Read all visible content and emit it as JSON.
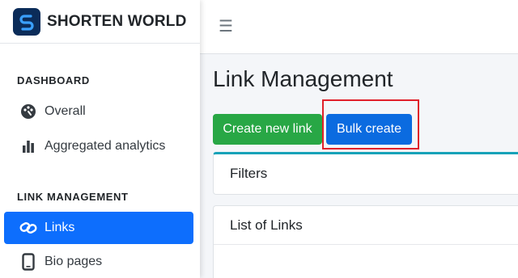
{
  "brand": {
    "name": "SHORTEN WORLD",
    "logo_icon": "s-link-logo"
  },
  "sidebar": {
    "sections": [
      {
        "title": "DASHBOARD"
      },
      {
        "title": "LINK MANAGEMENT"
      }
    ],
    "items": [
      {
        "label": "Overall",
        "icon": "palette-icon"
      },
      {
        "label": "Aggregated analytics",
        "icon": "bar-chart-icon"
      },
      {
        "label": "Links",
        "icon": "link-icon",
        "active": true
      },
      {
        "label": "Bio pages",
        "icon": "mobile-icon"
      }
    ]
  },
  "topbar": {
    "menu_icon": "hamburger-icon"
  },
  "main": {
    "title": "Link Management",
    "buttons": {
      "create_label": "Create new link",
      "bulk_label": "Bulk create"
    },
    "cards": [
      {
        "title": "Filters"
      },
      {
        "title": "List of Links"
      }
    ]
  },
  "colors": {
    "active": "#0d6efd",
    "success": "#28a745",
    "primary": "#0b6be0",
    "highlight": "#e0202a",
    "filter_accent": "#17a2b8"
  }
}
